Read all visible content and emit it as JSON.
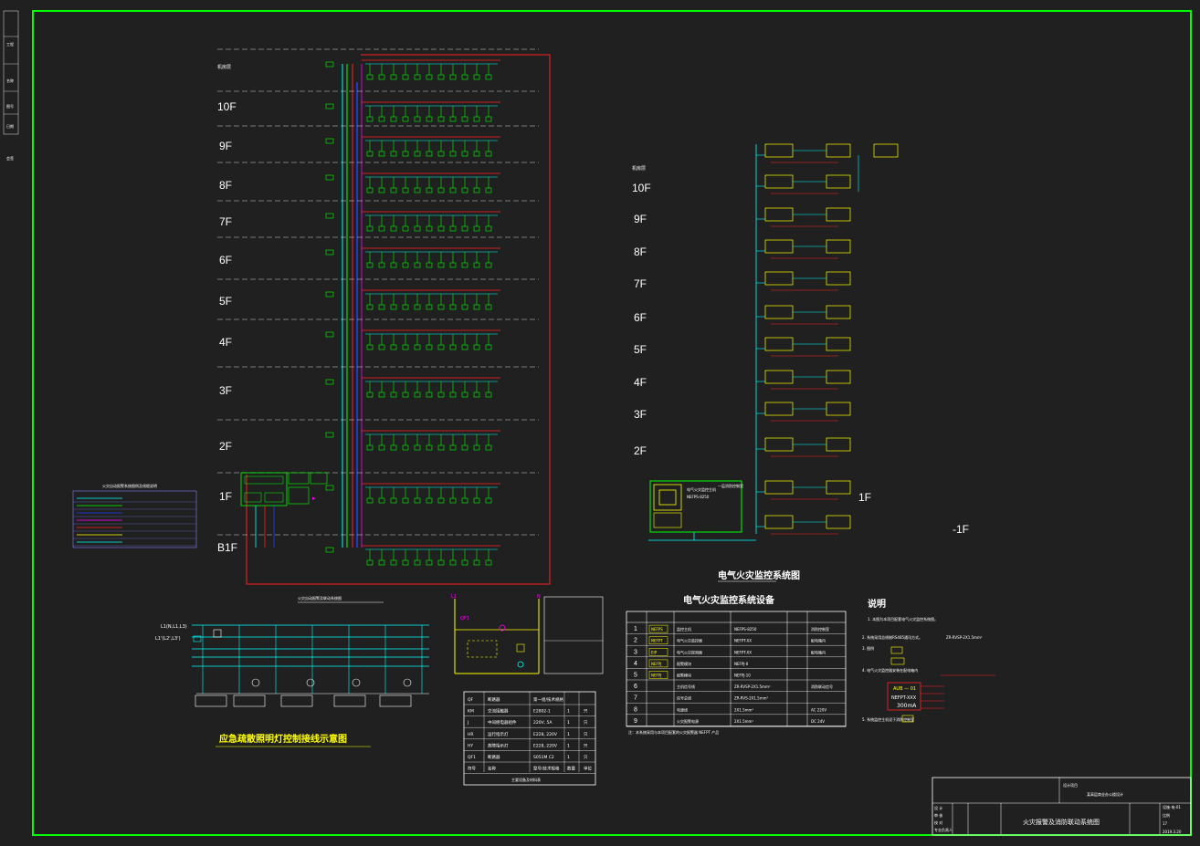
{
  "drawing": {
    "left_strip_labels": [
      "工程",
      "名称",
      "图号",
      "日期",
      "会签"
    ],
    "fire_system_floors": [
      "机房层",
      "10F",
      "9F",
      "8F",
      "7F",
      "6F",
      "5F",
      "4F",
      "3F",
      "2F",
      "1F",
      "B1F"
    ],
    "elec_system_floors": [
      "机房层",
      "10F",
      "9F",
      "8F",
      "7F",
      "6F",
      "5F",
      "4F",
      "3F",
      "2F",
      "1F",
      "-1F"
    ],
    "elec_system_title": "电气火灾监控系统图",
    "elec_equipment_title": "电气火灾监控系统设备",
    "notes_title": "说明",
    "emergency_title": "应急疏散照明灯控制接线示意图",
    "emergency_subtitle": "火灾自动报警及联动系统图",
    "legend_title": "火灾自动报警系统图例及线缆说明",
    "elec_table_rows": [
      {
        "no": "1",
        "code": "NEFPS",
        "name": "监控主机",
        "model": "NEFPS-8250",
        "qty": "",
        "note": "消防控制室"
      },
      {
        "no": "2",
        "code": "NEFPT",
        "name": "电气火灾监控器",
        "model": "NEFPT-XX",
        "qty": "",
        "note": "配电箱内"
      },
      {
        "no": "3",
        "code": "EIP",
        "name": "电气火灾探测器",
        "model": "NEFPT-XX",
        "qty": "",
        "note": "配电箱内"
      },
      {
        "no": "4",
        "code": "NEFPJ",
        "name": "报警模块",
        "model": "NEFPJ-II",
        "qty": "",
        "note": ""
      },
      {
        "no": "5",
        "code": "NEFPJ",
        "name": "报警模块",
        "model": "NEFPJ-10",
        "qty": "",
        "note": ""
      },
      {
        "no": "6",
        "code": "",
        "name": "主机信号线",
        "model": "ZR-RVSP-2X1.5mm²",
        "qty": "",
        "note": "消防联动信号"
      },
      {
        "no": "7",
        "code": "",
        "name": "信号总线",
        "model": "ZR-RVS-2X1.5mm²",
        "qty": "",
        "note": ""
      },
      {
        "no": "8",
        "code": "",
        "name": "电源线",
        "model": "2X1.5mm²",
        "qty": "",
        "note": "AC 220V"
      },
      {
        "no": "9",
        "code": "",
        "name": "火灾报警电源",
        "model": "2X1.5mm²",
        "qty": "",
        "note": "DC 24V"
      }
    ],
    "elec_table_footnote": "注：本系统采用与本项目配套的火灾报警器     NEFPT 产品",
    "relay_table": {
      "header": [
        "符号",
        "名称",
        "型号/技术规格",
        "数量",
        "单位"
      ],
      "rows": [
        [
          "QF",
          "断路器",
          "第一组/技术规格",
          "",
          ""
        ],
        [
          "KM",
          "交流接触器",
          "E2802-1",
          "1",
          "只"
        ],
        [
          "J",
          "中间继电器组件",
          "220V, 5A",
          "1",
          "只"
        ],
        [
          "HR",
          "运行指示灯",
          "E228, 220V",
          "1",
          "只"
        ],
        [
          "HY",
          "故障指示灯",
          "E228, 220V",
          "1",
          "只"
        ],
        [
          "QF1",
          "断路器",
          "S051M C2",
          "1",
          "只"
        ]
      ],
      "footer": "主要设备及材料表"
    },
    "notes_items": [
      "1. 本图为本项目配套电气火灾监控系统图。",
      "2. 系统采用总线制RS485通讯方式。",
      "3. 图例",
      "4. 电气火灾监控器安装在配电箱内",
      "5. 系统监控主机设于消防控制室"
    ],
    "notes_cable": "ZR-RVSP-2X1.5mm²",
    "notes_module": "NEFPT-XXX",
    "notes_current": "300mA",
    "notes_aub": "AUB — 01",
    "main_panel_title": "电气火灾监控主机",
    "main_panel_model": "NEFPS-8250",
    "main_panel_label": "一层消防控制室",
    "title_block": {
      "project": "某高层商业办公楼设计",
      "drawing_title": "火灾报警及消防联动系统图",
      "drawing_no": "设施-电-01",
      "scale": "比例",
      "sheet": "17",
      "date": "2019.3.20",
      "rows": [
        "设 计",
        "审 核",
        "校 对",
        "专业负责人"
      ],
      "role_left": [
        "设计",
        "校对",
        "审核",
        "项目负责人"
      ]
    }
  }
}
